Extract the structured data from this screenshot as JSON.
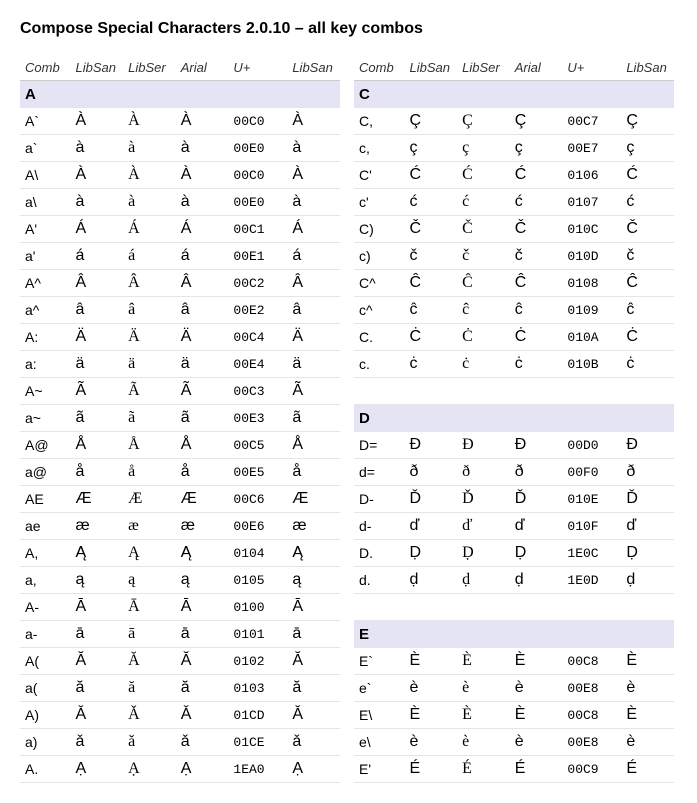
{
  "title": "Compose Special Characters 2.0.10 – all key combos",
  "headers": [
    "Comb",
    "LibSan",
    "LibSer",
    "Arial",
    "U+",
    "LibSan"
  ],
  "left": [
    {
      "section": "A"
    },
    {
      "row": [
        "A`",
        "À",
        "À",
        "À",
        "00C0",
        "À"
      ]
    },
    {
      "row": [
        "a`",
        "à",
        "à",
        "à",
        "00E0",
        "à"
      ]
    },
    {
      "row": [
        "A\\",
        "À",
        "À",
        "À",
        "00C0",
        "À"
      ]
    },
    {
      "row": [
        "a\\",
        "à",
        "à",
        "à",
        "00E0",
        "à"
      ]
    },
    {
      "row": [
        "A'",
        "Á",
        "Á",
        "Á",
        "00C1",
        "Á"
      ]
    },
    {
      "row": [
        "a'",
        "á",
        "á",
        "á",
        "00E1",
        "á"
      ]
    },
    {
      "row": [
        "A^",
        "Â",
        "Â",
        "Â",
        "00C2",
        "Â"
      ]
    },
    {
      "row": [
        "a^",
        "â",
        "â",
        "â",
        "00E2",
        "â"
      ]
    },
    {
      "row": [
        "A:",
        "Ä",
        "Ä",
        "Ä",
        "00C4",
        "Ä"
      ]
    },
    {
      "row": [
        "a:",
        "ä",
        "ä",
        "ä",
        "00E4",
        "ä"
      ]
    },
    {
      "row": [
        "A~",
        "Ã",
        "Ã",
        "Ã",
        "00C3",
        "Ã"
      ]
    },
    {
      "row": [
        "a~",
        "ã",
        "ã",
        "ã",
        "00E3",
        "ã"
      ]
    },
    {
      "row": [
        "A@",
        "Å",
        "Å",
        "Å",
        "00C5",
        "Å"
      ]
    },
    {
      "row": [
        "a@",
        "å",
        "å",
        "å",
        "00E5",
        "å"
      ]
    },
    {
      "row": [
        "AE",
        "Æ",
        "Æ",
        "Æ",
        "00C6",
        "Æ"
      ]
    },
    {
      "row": [
        "ae",
        "æ",
        "æ",
        "æ",
        "00E6",
        "æ"
      ]
    },
    {
      "row": [
        "A,",
        "Ą",
        "Ą",
        "Ą",
        "0104",
        "Ą"
      ]
    },
    {
      "row": [
        "a,",
        "ą",
        "ą",
        "ą",
        "0105",
        "ą"
      ]
    },
    {
      "row": [
        "A-",
        "Ā",
        "Ā",
        "Ā",
        "0100",
        "Ā"
      ]
    },
    {
      "row": [
        "a-",
        "ā",
        "ā",
        "ā",
        "0101",
        "ā"
      ]
    },
    {
      "row": [
        "A(",
        "Ă",
        "Ă",
        "Ă",
        "0102",
        "Ă"
      ]
    },
    {
      "row": [
        "a(",
        "ă",
        "ă",
        "ă",
        "0103",
        "ă"
      ]
    },
    {
      "row": [
        "A)",
        "Ǎ",
        "Ǎ",
        "Ǎ",
        "01CD",
        "Ǎ"
      ]
    },
    {
      "row": [
        "a)",
        "ǎ",
        "ǎ",
        "ǎ",
        "01CE",
        "ǎ"
      ]
    },
    {
      "row": [
        "A.",
        "Ạ",
        "Ạ",
        "Ạ",
        "1EA0",
        "Ạ"
      ]
    }
  ],
  "right": [
    {
      "section": "C"
    },
    {
      "row": [
        "C,",
        "Ç",
        "Ç",
        "Ç",
        "00C7",
        "Ç"
      ]
    },
    {
      "row": [
        "c,",
        "ç",
        "ç",
        "ç",
        "00E7",
        "ç"
      ]
    },
    {
      "row": [
        "C'",
        "Ć",
        "Ć",
        "Ć",
        "0106",
        "Ć"
      ]
    },
    {
      "row": [
        "c'",
        "ć",
        "ć",
        "ć",
        "0107",
        "ć"
      ]
    },
    {
      "row": [
        "C)",
        "Č",
        "Č",
        "Č",
        "010C",
        "Č"
      ]
    },
    {
      "row": [
        "c)",
        "č",
        "č",
        "č",
        "010D",
        "č"
      ]
    },
    {
      "row": [
        "C^",
        "Ĉ",
        "Ĉ",
        "Ĉ",
        "0108",
        "Ĉ"
      ]
    },
    {
      "row": [
        "c^",
        "ĉ",
        "ĉ",
        "ĉ",
        "0109",
        "ĉ"
      ]
    },
    {
      "row": [
        "C.",
        "Ċ",
        "Ċ",
        "Ċ",
        "010A",
        "Ċ"
      ]
    },
    {
      "row": [
        "c.",
        "ċ",
        "ċ",
        "ċ",
        "010B",
        "ċ"
      ]
    },
    {
      "blank": true
    },
    {
      "section": "D"
    },
    {
      "row": [
        "D=",
        "Đ",
        "Đ",
        "Đ",
        "00D0",
        "Đ"
      ]
    },
    {
      "row": [
        "d=",
        "ð",
        "ð",
        "ð",
        "00F0",
        "ð"
      ]
    },
    {
      "row": [
        "D-",
        "Ď",
        "Ď",
        "Ď",
        "010E",
        "Ď"
      ]
    },
    {
      "row": [
        "d-",
        "ď",
        "ď",
        "ď",
        "010F",
        "ď"
      ]
    },
    {
      "row": [
        "D.",
        "Ḍ",
        "Ḍ",
        "Ḍ",
        "1E0C",
        "Ḍ"
      ]
    },
    {
      "row": [
        "d.",
        "ḍ",
        "ḍ",
        "ḍ",
        "1E0D",
        "ḍ"
      ]
    },
    {
      "blank": true
    },
    {
      "section": "E"
    },
    {
      "row": [
        "E`",
        "È",
        "È",
        "È",
        "00C8",
        "È"
      ]
    },
    {
      "row": [
        "e`",
        "è",
        "è",
        "è",
        "00E8",
        "è"
      ]
    },
    {
      "row": [
        "E\\",
        "È",
        "È",
        "È",
        "00C8",
        "È"
      ]
    },
    {
      "row": [
        "e\\",
        "è",
        "è",
        "è",
        "00E8",
        "è"
      ]
    },
    {
      "row": [
        "E'",
        "É",
        "É",
        "É",
        "00C9",
        "É"
      ]
    }
  ]
}
